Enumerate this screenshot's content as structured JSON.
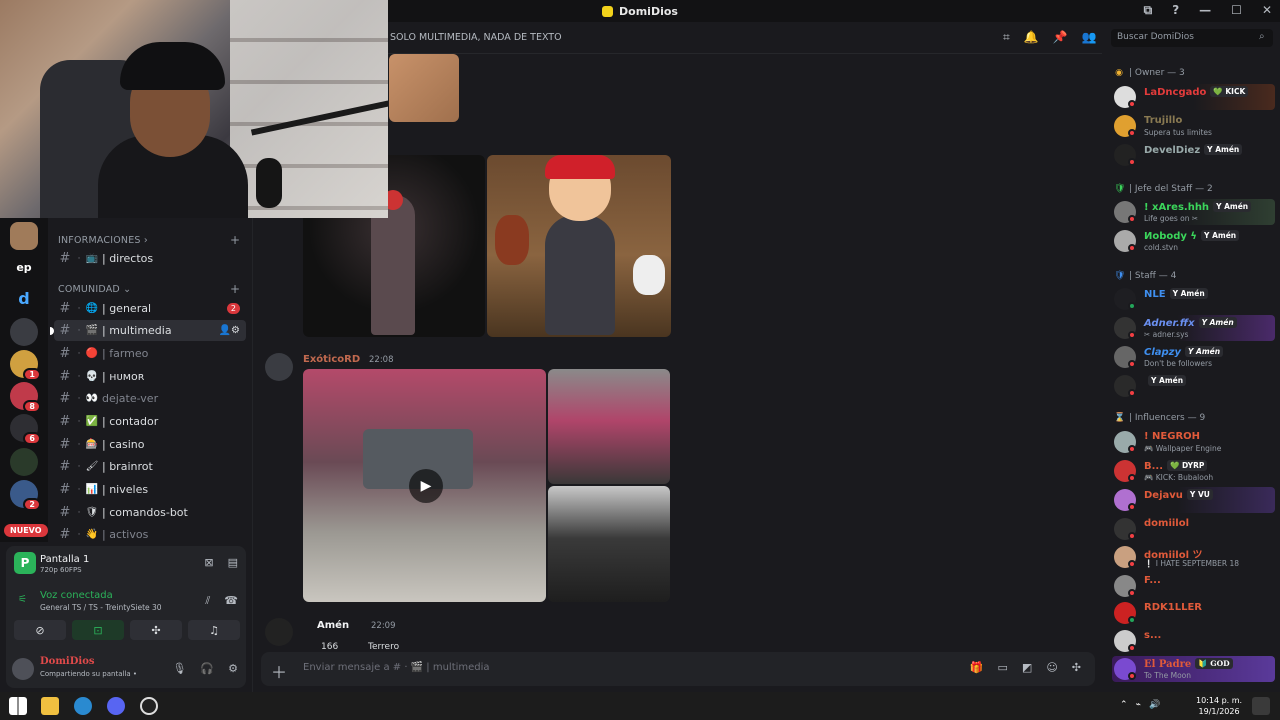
{
  "window": {
    "title": "DomiDios",
    "controls": [
      "⧉",
      "?",
      "—",
      "☐",
      "✕"
    ]
  },
  "channel_header": {
    "topic": "SOLO MULTIMEDIA, NADA DE TEXTO"
  },
  "search": {
    "placeholder": "Buscar DomiDios"
  },
  "rail": {
    "nuevo_label": "NUEVO",
    "ep_label": "ep",
    "da_label": "d",
    "badges": [
      "1",
      "8",
      "6",
      "2"
    ]
  },
  "categories": [
    {
      "name": "INFORMACIONES ›"
    },
    {
      "name": "COMUNIDAD ⌄"
    }
  ],
  "channels": [
    {
      "emoji": "📺",
      "name": "| directos",
      "badge": ""
    },
    {
      "emoji": "🌐",
      "name": "| general",
      "badge": "2"
    },
    {
      "emoji": "🎬",
      "name": "| multimedia",
      "badge": ""
    },
    {
      "emoji": "🔴",
      "name": "| farmeo",
      "badge": ""
    },
    {
      "emoji": "💀",
      "name": "| ʜᴜᴍᴏʀ",
      "badge": ""
    },
    {
      "emoji": "👀",
      "name": "dejate-ver",
      "badge": ""
    },
    {
      "emoji": "✅",
      "name": "| contador",
      "badge": ""
    },
    {
      "emoji": "🎰",
      "name": "| casino",
      "badge": ""
    },
    {
      "emoji": "🖌",
      "name": "| brainrot",
      "badge": ""
    },
    {
      "emoji": "📊",
      "name": "| niveles",
      "badge": ""
    },
    {
      "emoji": "🛡",
      "name": "| comandos-bot",
      "badge": ""
    },
    {
      "emoji": "👋",
      "name": "| activos",
      "badge": ""
    }
  ],
  "messages": [
    {
      "author": "ExóticoRD",
      "time": "22:08"
    },
    {
      "author": "Amén",
      "time": "22:09"
    }
  ],
  "forward": {
    "count": "166",
    "label": "Terrero"
  },
  "composer": {
    "placeholder": "Enviar mensaje a # · 🎬 | multimedia"
  },
  "roles": [
    {
      "name": "| Owner — 3",
      "icon": "◉"
    },
    {
      "name": "| Jefe del Staff — 2",
      "icon": "🛡"
    },
    {
      "name": "| Staff — 4",
      "icon": "🛡"
    },
    {
      "name": "| Influencers — 9",
      "icon": "⌛"
    }
  ],
  "members": [
    {
      "name": "LaDncgado",
      "status": "",
      "tag": "💚 KICK",
      "color": "#e23b3b"
    },
    {
      "name": "Trujillo",
      "status": "Supera tus limites",
      "tag": "",
      "color": "#8a7a52"
    },
    {
      "name": "DevelDiez",
      "status": "",
      "tag": "Y Amén",
      "color": "#1c1c1c"
    },
    {
      "name": "! xAres.hhh",
      "status": "Life goes on ✂",
      "tag": "Y Amén",
      "color": "#3bd65b"
    },
    {
      "name": "Иobody ϟ",
      "status": "cold.stvn",
      "tag": "Y Amén",
      "color": "#3bd65b"
    },
    {
      "name": "NLE",
      "status": "",
      "tag": "Y Amén",
      "color": "#3f8ff0"
    },
    {
      "name": "Adner.ffx",
      "status": "✂ adner.sys",
      "tag": "Y Amén",
      "color": "#3f8ff0"
    },
    {
      "name": "Clapzy",
      "status": "Don't be followers",
      "tag": "Y Amén",
      "color": "#3f8ff0"
    },
    {
      "name": "",
      "status": "",
      "tag": "Y Amén",
      "color": "#3f8ff0"
    },
    {
      "name": "! NEGROH",
      "status": "🎮 Wallpaper Engine",
      "tag": "",
      "color": "#e05a3a"
    },
    {
      "name": "B...",
      "status": "🎮 KICK: Bubalooh",
      "tag": "💚 DYRP",
      "color": "#e05a3a"
    },
    {
      "name": "Dejavu",
      "status": "",
      "tag": "Y VU",
      "color": "#e05a3a"
    },
    {
      "name": "domiilol",
      "status": "",
      "tag": "",
      "color": "#e05a3a"
    },
    {
      "name": "domiilol ツ",
      "status": "❕ I HATE SEPTEMBER 18",
      "tag": "",
      "color": "#e05a3a"
    },
    {
      "name": "F...",
      "status": "",
      "tag": "",
      "color": "#e05a3a"
    },
    {
      "name": "RDK1LLER",
      "status": "",
      "tag": "",
      "color": "#e05a3a"
    },
    {
      "name": "s...",
      "status": "",
      "tag": "",
      "color": "#e05a3a"
    },
    {
      "name": "El Padre",
      "status": "To The Moon",
      "tag": "🔰 GOD",
      "color": "#e05a3a"
    }
  ],
  "panel": {
    "screen_badge": "P",
    "screen_title": "Pantalla 1",
    "screen_sub": "720p 60FPS",
    "voice_title": "Voz conectada",
    "voice_sub": "General TS / TS - TreintySiete 30",
    "user_name": "DomiDios",
    "user_status": "Compartiendo su pantalla •"
  },
  "taskbar": {
    "time": "10:14 p. m.",
    "date": "19/1/2026"
  },
  "colors": {
    "accent": "#2bb35a",
    "danger": "#da373c",
    "background": "#1a1a1e"
  }
}
